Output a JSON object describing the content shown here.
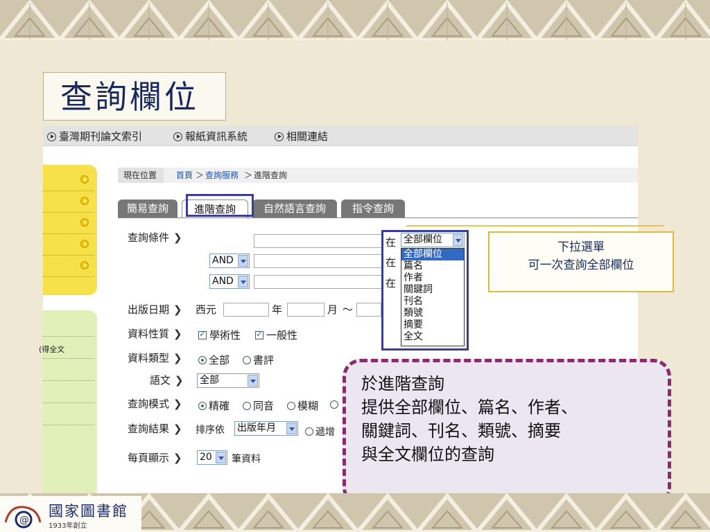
{
  "slide": {
    "title": "查詢欄位"
  },
  "site_nav": {
    "items": [
      "臺灣期刊論文索引",
      "報紙資訊系統",
      "相關連結"
    ]
  },
  "sidebar": {
    "second_panel_text": "(得全文"
  },
  "breadcrumb": {
    "label": "現在位置",
    "home": "首頁",
    "sep": "＞",
    "level1": "查詢服務",
    "current": "進階查詢"
  },
  "tabs": [
    {
      "label": "簡易查詢"
    },
    {
      "label": "進階查詢",
      "active": true
    },
    {
      "label": "自然語言查詢"
    },
    {
      "label": "指令查詢"
    }
  ],
  "form": {
    "query_condition_label": "查詢條件",
    "bool_op_1": "AND",
    "bool_op_2": "AND",
    "in_label": "在",
    "field_select_value": "全部欄位",
    "date_label": "出版日期",
    "era_label": "西元",
    "year_label": "年",
    "month_label": "月",
    "range_sep": "～",
    "nature_label": "資料性質",
    "nature_options": [
      "學術性",
      "一般性"
    ],
    "type_label": "資料類型",
    "type_options": [
      "全部",
      "書評"
    ],
    "lang_label": "語文",
    "lang_value": "全部",
    "mode_label": "查詢模式",
    "mode_options": [
      "精確",
      "同音",
      "模糊"
    ],
    "result_label": "查詢結果",
    "sort_prefix": "排序依",
    "sort_value": "出版年月",
    "order_option": "遞增",
    "perpage_label": "每頁顯示",
    "perpage_value": "20",
    "perpage_suffix": "筆資料"
  },
  "dropdown_options": [
    "全部欄位",
    "篇名",
    "作者",
    "關鍵詞",
    "刊名",
    "類號",
    "摘要",
    "全文"
  ],
  "callout_small": {
    "line1": "下拉選單",
    "line2": "可一次查詢全部欄位"
  },
  "callout_large": {
    "lines": [
      "於進階查詢",
      "提供全部欄位、篇名、作者、",
      "關鍵詞、刊名、類號、摘要",
      "與全文欄位的查詢"
    ]
  },
  "logo": {
    "name": "國家圖書館",
    "year": "1933年創立"
  },
  "colors": {
    "highlight_box": "#3a3d98",
    "callout_border": "#8a2b6c",
    "callout_bg": "#ece6f1",
    "title_text": "#17285c"
  }
}
